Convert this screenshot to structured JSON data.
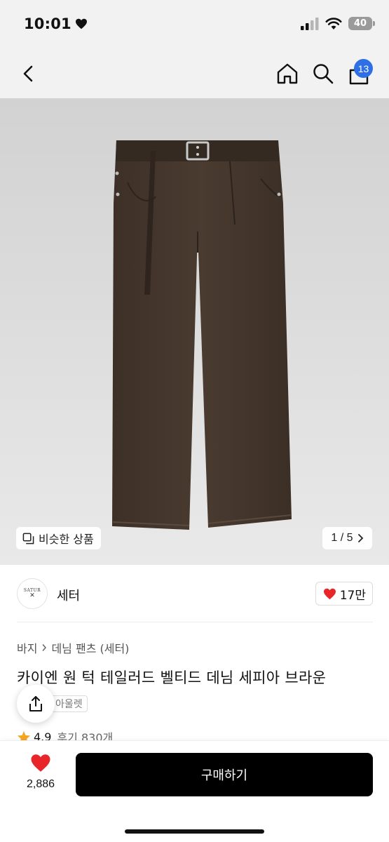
{
  "status": {
    "time": "10:01",
    "battery": "40"
  },
  "nav": {
    "cart_count": "13"
  },
  "gallery": {
    "similar_label": "비슷한 상품",
    "pager": "1 / 5"
  },
  "brand": {
    "logo_text": "SATUR",
    "name": "세터",
    "likes": "17만"
  },
  "product": {
    "breadcrumb": [
      "바지",
      "데님 팬츠 (세터)"
    ],
    "title": "카이엔 원 턱 테일러드 벨티드 데님 세피아 브라운",
    "tag": "아울렛",
    "rating": "4.9",
    "reviews": "후기 830개"
  },
  "bottom": {
    "wish_count": "2,886",
    "buy_label": "구매하기"
  },
  "colors": {
    "accent_blue": "#2f6fe6",
    "heart_red": "#e8262a",
    "star": "#f5a623",
    "button_black": "#000000"
  }
}
